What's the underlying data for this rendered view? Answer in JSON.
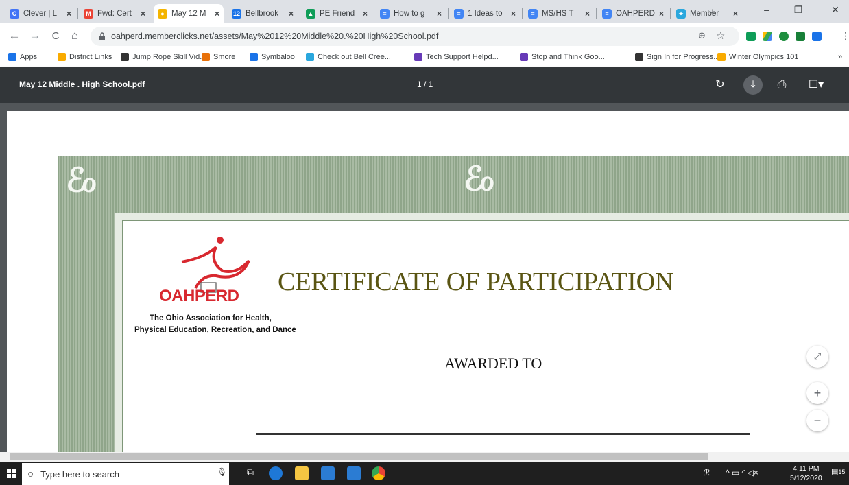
{
  "tabs": [
    {
      "title": "Clever | L",
      "icon": "clever-icon",
      "color": "#4274f6",
      "glyph": "C"
    },
    {
      "title": "Fwd: Cert",
      "icon": "gmail-icon",
      "color": "#ea4335",
      "glyph": "M"
    },
    {
      "title": "May 12 M",
      "icon": "oahperd-icon",
      "color": "#f4b400",
      "glyph": "●",
      "active": true
    },
    {
      "title": "Bellbrook",
      "icon": "calendar-icon",
      "color": "#1a73e8",
      "glyph": "12"
    },
    {
      "title": "PE Friend",
      "icon": "drive-icon",
      "color": "#0f9d58",
      "glyph": "▲"
    },
    {
      "title": "How to g",
      "icon": "docs-icon",
      "color": "#4285f4",
      "glyph": "≡"
    },
    {
      "title": "1 Ideas to",
      "icon": "docs-icon",
      "color": "#4285f4",
      "glyph": "≡"
    },
    {
      "title": "MS/HS T",
      "icon": "docs-icon",
      "color": "#4285f4",
      "glyph": "≡"
    },
    {
      "title": "OAHPERD",
      "icon": "docs-icon",
      "color": "#4285f4",
      "glyph": "≡"
    },
    {
      "title": "Member",
      "icon": "memberclicks-icon",
      "color": "#2aa7dd",
      "glyph": "★"
    }
  ],
  "new_tab": "+",
  "window": {
    "minimize": "–",
    "restore": "❐",
    "close": "✕"
  },
  "nav": {
    "back": "←",
    "forward": "→",
    "reload": "C",
    "home": "⌂"
  },
  "address": {
    "url": "oahperd.memberclicks.net/assets/May%2012%20Middle%20.%20High%20School.pdf",
    "lock": "lock-icon"
  },
  "bookmarks": [
    {
      "label": "Apps",
      "color": "#1a73e8"
    },
    {
      "label": "District Links",
      "color": "#f9ab00"
    },
    {
      "label": "Jump Rope Skill Vid...",
      "color": "#333"
    },
    {
      "label": "Smore",
      "color": "#e8710a"
    },
    {
      "label": "Symbaloo",
      "color": "#1a73e8"
    },
    {
      "label": "Check out Bell Cree...",
      "color": "#2aa7dd"
    },
    {
      "label": "Tech Support Helpd...",
      "color": "#673ab7"
    },
    {
      "label": "Stop and Think Goo...",
      "color": "#673ab7"
    },
    {
      "label": "Sign In for Progress...",
      "color": "#333"
    },
    {
      "label": "Winter Olympics 101",
      "color": "#f9ab00"
    }
  ],
  "bookmarks_more": "»",
  "pdf": {
    "title": "May 12 Middle . High School.pdf",
    "page": "1 / 1"
  },
  "certificate": {
    "org_name": "OAHPERD",
    "org_full_1": "The Ohio Association for Health,",
    "org_full_2": "Physical Education, Recreation, and Dance",
    "title": "CERTIFICATE OF PARTICIPATION",
    "awarded": "AWARDED TO"
  },
  "zoom": {
    "fit": "⤢",
    "in": "+",
    "out": "−"
  },
  "taskbar": {
    "search_placeholder": "Type here to search",
    "time": "4:11 PM",
    "date": "5/12/2020",
    "notifications": "15"
  }
}
